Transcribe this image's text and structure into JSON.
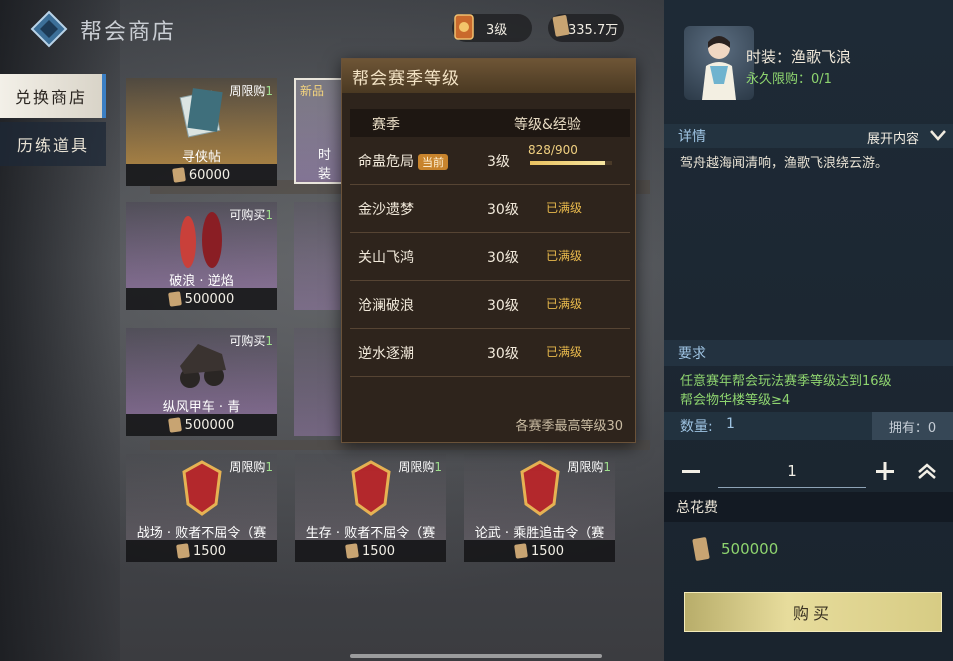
{
  "header": {
    "title": "帮会商店",
    "level_badge": "3级",
    "currency_amount": "335.7万"
  },
  "side_tabs": [
    {
      "label": "兑换商店"
    },
    {
      "label": "历练道具"
    }
  ],
  "cards": [
    {
      "tag": "周限购",
      "tag_num": "1",
      "name": "寻侠帖",
      "price": "60000"
    },
    {
      "tag": "可购买",
      "tag_num": "1",
      "name": "破浪 · 逆焰",
      "price": "500000"
    },
    {
      "tag": "可购买",
      "tag_num": "1",
      "name": "纵风甲车 · 青",
      "price": "500000"
    },
    {
      "tag": "周限购",
      "tag_num": "1",
      "name": "战场 · 败者不屈令（赛",
      "price": "1500"
    },
    {
      "tag": "周限购",
      "tag_num": "1",
      "name": "生存 · 败者不屈令（赛",
      "price": "1500"
    },
    {
      "tag": "周限购",
      "tag_num": "1",
      "name": "论武 · 乘胜追击令（赛",
      "price": "1500"
    }
  ],
  "new_card": {
    "label": "新品",
    "partial_name": "时装"
  },
  "popup": {
    "title": "帮会赛季等级",
    "col_season": "赛季",
    "col_level": "等级&经验",
    "rows": [
      {
        "season": "命蛊危局",
        "current_badge": "当前",
        "level": "3级",
        "xp": "828/900",
        "xp_progress": 0.92
      },
      {
        "season": "金沙遗梦",
        "level": "30级",
        "status": "已满级"
      },
      {
        "season": "关山飞鸿",
        "level": "30级",
        "status": "已满级"
      },
      {
        "season": "沧澜破浪",
        "level": "30级",
        "status": "已满级"
      },
      {
        "season": "逆水逐潮",
        "level": "30级",
        "status": "已满级"
      }
    ],
    "footer": "各赛季最高等级30"
  },
  "right_panel": {
    "fashion_title": "时装：渔歌飞浪",
    "limit": "永久限购：0/1",
    "detail_label": "详情",
    "expand_label": "展开内容",
    "description": "驾舟越海闻清响，渔歌飞浪绕云游。",
    "requirement_label": "要求",
    "requirements": [
      "任意赛年帮会玩法赛季等级达到16级",
      "帮会物华楼等级≥4"
    ],
    "quantity_label": "数量:",
    "quantity_value": "1",
    "owned": "拥有：0",
    "stepper_value": "1",
    "total_label": "总花费",
    "total_cost": "500000",
    "buy_label": "购买"
  },
  "colors": {
    "accent_green": "#8ed46f",
    "popup_bg": "#2e241c",
    "buy_gold": "#e7dc9c"
  }
}
